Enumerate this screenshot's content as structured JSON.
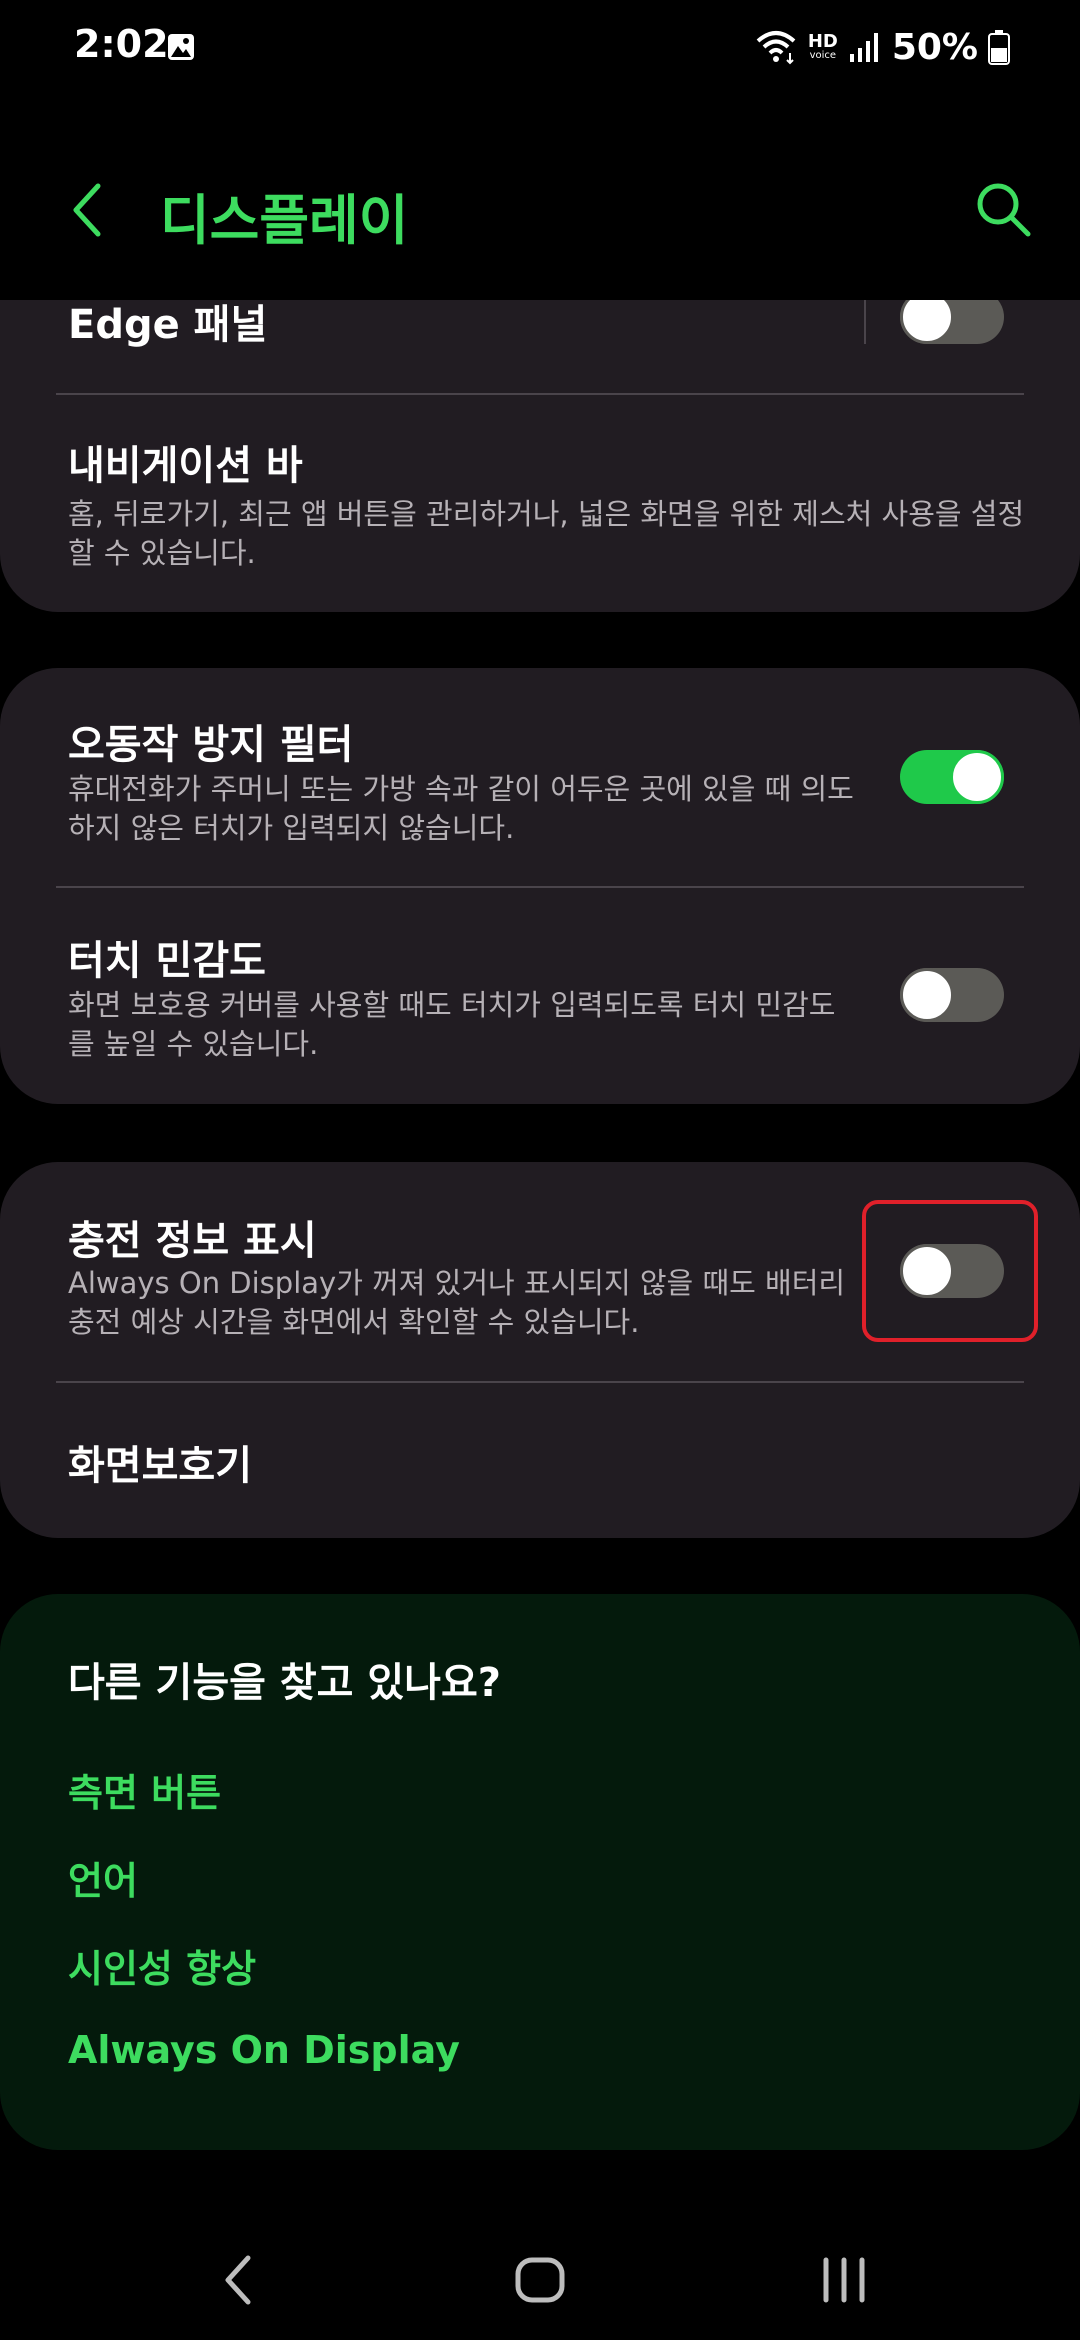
{
  "status_bar": {
    "time": "2:02",
    "hd_label": "HD",
    "voice_label": "voice",
    "battery_percent": "50%",
    "icons": [
      "gallery-icon",
      "wifi-icon",
      "hd-voice-icon",
      "signal-icon",
      "battery-icon"
    ]
  },
  "header": {
    "title": "디스플레이",
    "back_icon": "chevron-left-icon",
    "search_icon": "search-icon"
  },
  "colors": {
    "accent": "#3ddc5f",
    "toggle_on": "#1fc94a",
    "toggle_off": "#5b5a56",
    "card_bg": "#211c22",
    "related_bg": "#041a0c",
    "highlight": "#e0202a"
  },
  "settings": {
    "edge_panel": {
      "title": "Edge 패널",
      "enabled": false
    },
    "navigation_bar": {
      "title": "내비게이션 바",
      "description": "홈, 뒤로가기, 최근 앱 버튼을 관리하거나, 넓은 화면을 위한 제스처 사용을 설정할 수 있습니다."
    },
    "accidental_touch": {
      "title": "오동작 방지 필터",
      "description": "휴대전화가 주머니 또는 가방 속과 같이 어두운 곳에 있을 때 의도하지 않은 터치가 입력되지 않습니다.",
      "enabled": true
    },
    "touch_sensitivity": {
      "title": "터치 민감도",
      "description": "화면 보호용 커버를 사용할 때도 터치가 입력되도록 터치 민감도를 높일 수 있습니다.",
      "enabled": false
    },
    "charging_info": {
      "title": "충전 정보 표시",
      "description": "Always On Display가 꺼져 있거나 표시되지 않을 때도 배터리 충전 예상 시간을 화면에서 확인할 수 있습니다.",
      "enabled": false
    },
    "screen_saver": {
      "title": "화면보호기"
    }
  },
  "related": {
    "title": "다른 기능을 찾고 있나요?",
    "links": [
      "측면 버튼",
      "언어",
      "시인성 향상",
      "Always On Display"
    ]
  },
  "nav_bar": {
    "icons": [
      "back-icon",
      "home-icon",
      "recents-icon"
    ]
  }
}
